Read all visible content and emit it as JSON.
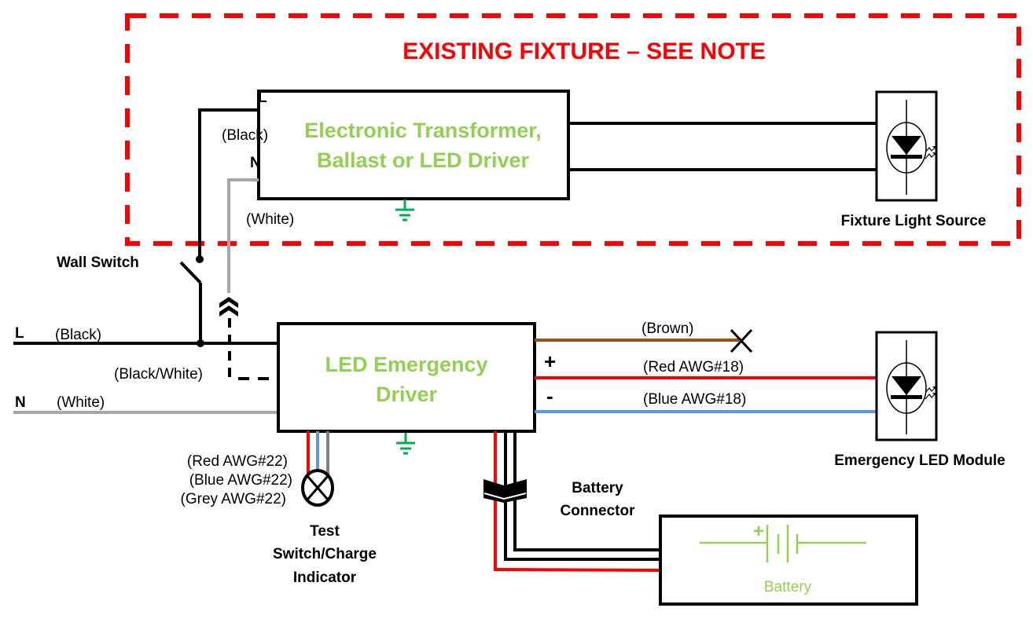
{
  "title": "EXISTING FIXTURE – SEE NOTE",
  "colors": {
    "fixture_border": "#ff0000",
    "component_text": "#92d050",
    "ground": "#00b050",
    "wire_black": "#000000",
    "wire_white": "#a6a6a6",
    "wire_brown": "#9c5010",
    "wire_red": "#ff0000",
    "wire_blue": "#5b9bd5",
    "wire_grey": "#808080"
  },
  "existing_fixture": {
    "driver_label_line1": "Electronic Transformer,",
    "driver_label_line2": "Ballast or LED Driver",
    "input_l": "L",
    "input_n": "N",
    "black_label": "(Black)",
    "white_label": "(White)",
    "light_source_label": "Fixture Light Source"
  },
  "supply": {
    "l_label": "L",
    "n_label": "N",
    "black_label": "(Black)",
    "white_label": "(White)",
    "switched_label": "(Black/White)",
    "wall_switch_label": "Wall Switch"
  },
  "emergency_driver": {
    "label_line1": "LED Emergency",
    "label_line2": "Driver",
    "plus": "+",
    "minus": "-",
    "brown_label": "(Brown)",
    "red_label": "(Red AWG#18)",
    "blue_label": "(Blue AWG#18)",
    "module_label": "Emergency LED Module",
    "test_wires": [
      "(Red AWG#22)",
      "(Blue AWG#22)",
      "(Grey AWG#22)"
    ],
    "test_label_lines": [
      "Test",
      "Switch/Charge",
      "Indicator"
    ],
    "battery_connector_lines": [
      "Battery",
      "Connector"
    ],
    "battery_label": "Battery",
    "battery_plus": "+"
  }
}
